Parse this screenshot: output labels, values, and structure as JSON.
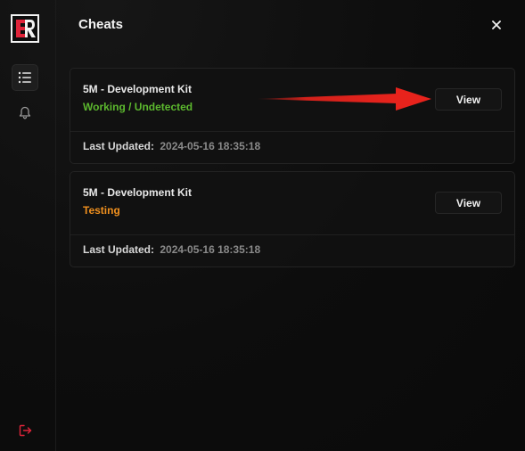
{
  "header": {
    "title": "Cheats",
    "close_glyph": "✕"
  },
  "sidebar": {
    "logo_text": "ER",
    "items": [
      {
        "icon": "list-icon",
        "active": true
      },
      {
        "icon": "bell-icon",
        "active": false
      }
    ],
    "logout_icon": "logout-icon"
  },
  "cards": [
    {
      "title": "5M - Development Kit",
      "status": "Working / Undetected",
      "status_color": "#5cb82e",
      "view_label": "View",
      "updated_label": "Last Updated:",
      "updated_value": "2024-05-16 18:35:18"
    },
    {
      "title": "5M - Development Kit",
      "status": "Testing",
      "status_color": "#f0901e",
      "view_label": "View",
      "updated_label": "Last Updated:",
      "updated_value": "2024-05-16 18:35:18"
    }
  ],
  "colors": {
    "accent_red": "#e0243a",
    "background": "#0b0b0b",
    "annotation_arrow": "#e8231c"
  }
}
